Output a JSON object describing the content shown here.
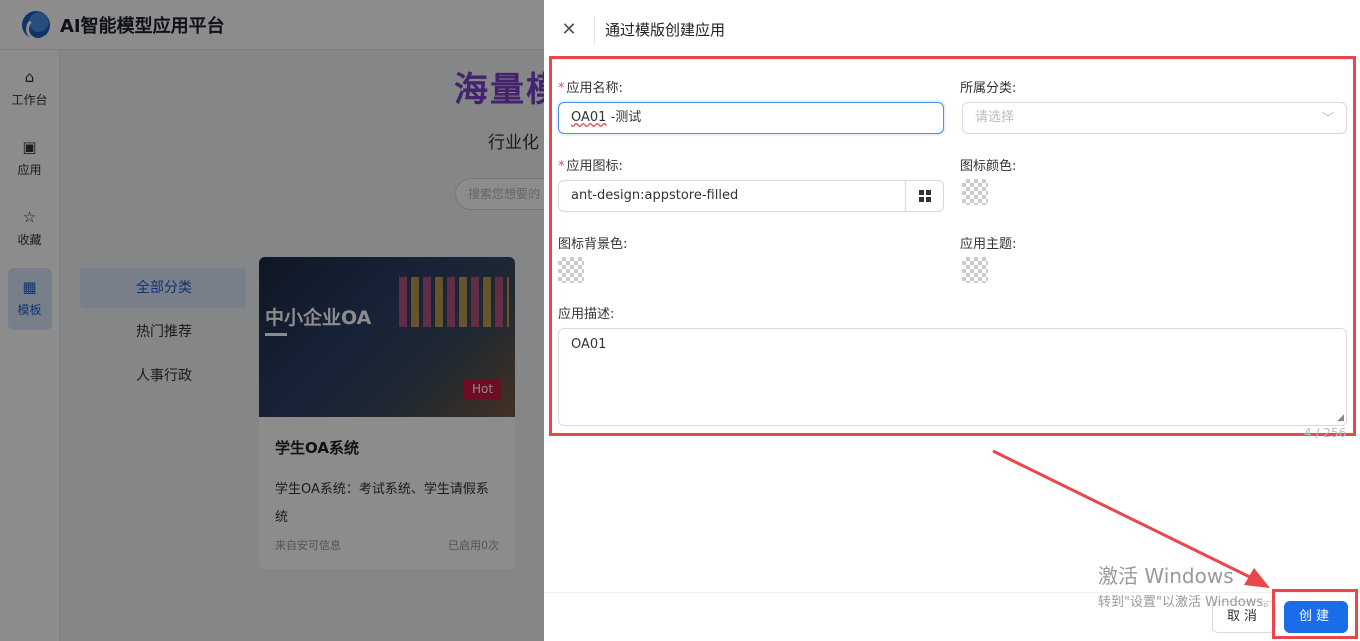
{
  "app": {
    "title": "AI智能模型应用平台"
  },
  "sidebar": {
    "items": [
      {
        "label": "工作台",
        "icon": "home-icon"
      },
      {
        "label": "应用",
        "icon": "apps-icon"
      },
      {
        "label": "收藏",
        "icon": "star-icon"
      },
      {
        "label": "模板",
        "icon": "template-icon",
        "active": true
      }
    ]
  },
  "background": {
    "hero_title": "海量模",
    "hero_subtitle": "行业化",
    "search_placeholder": "搜索您想要的",
    "categories": [
      "全部分类",
      "热门推荐",
      "人事行政"
    ],
    "card": {
      "image_title": "中小企业OA",
      "badge": "Hot",
      "title": "学生OA系统",
      "description": "学生OA系统：考试系统、学生请假系统",
      "source": "来自安可信息",
      "usage": "已启用0次"
    }
  },
  "drawer": {
    "title": "通过模版创建应用",
    "fields": {
      "app_name": {
        "label": "应用名称:",
        "required": true,
        "value": "OA01 -测试",
        "value_main": "OA01",
        "value_rest": " -测试"
      },
      "category": {
        "label": "所属分类:",
        "placeholder": "请选择"
      },
      "app_icon": {
        "label": "应用图标:",
        "required": true,
        "value": "ant-design:appstore-filled"
      },
      "icon_color": {
        "label": "图标颜色:"
      },
      "icon_bg_color": {
        "label": "图标背景色:"
      },
      "app_theme": {
        "label": "应用主题:"
      },
      "description": {
        "label": "应用描述:",
        "value": "OA01",
        "counter": "4 / 256"
      }
    },
    "buttons": {
      "cancel": "取消",
      "create": "创建"
    }
  },
  "watermark": {
    "line1": "激活 Windows",
    "line2": "转到\"设置\"以激活 Windows。"
  },
  "colors": {
    "accent": "#1a6ce8",
    "annotation": "#e8474c",
    "hot_badge": "#c8183c"
  }
}
